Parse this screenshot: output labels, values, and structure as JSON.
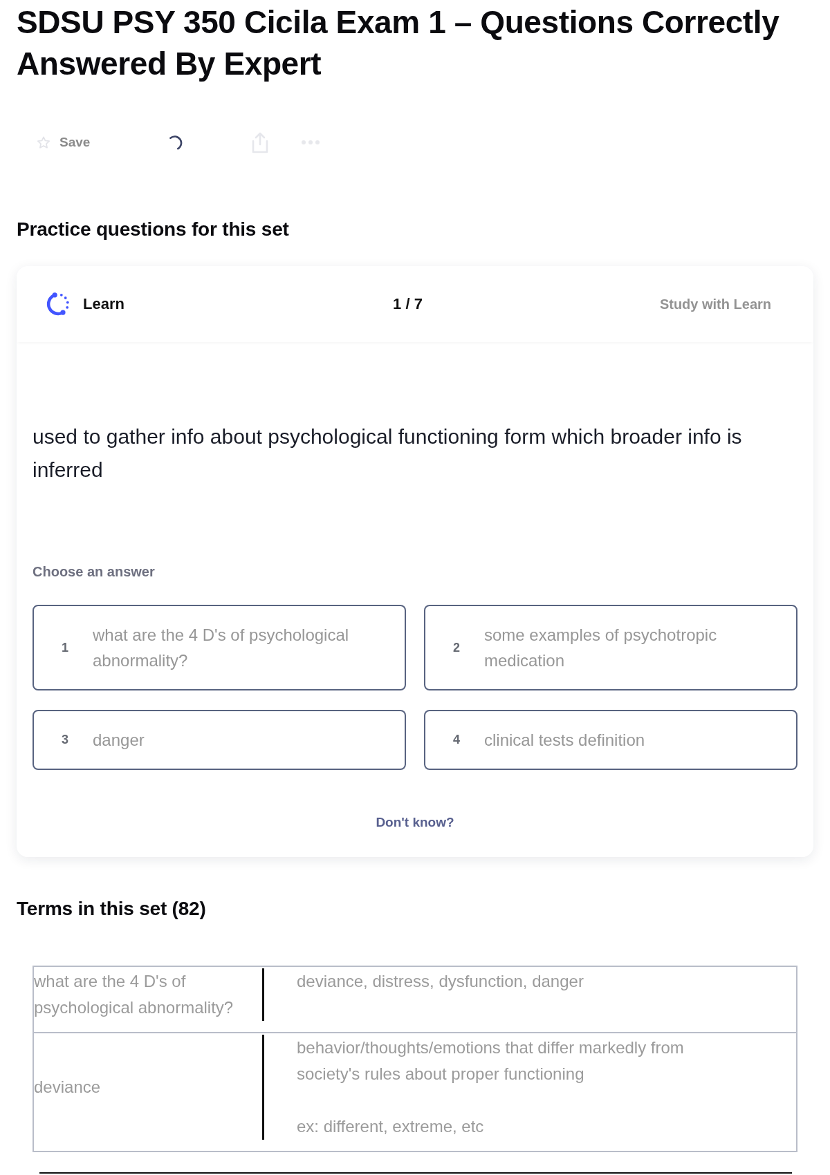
{
  "title": "SDSU PSY 350 Cicila Exam 1 – Questions Correctly Answered By Expert",
  "toolbar": {
    "save_label": "Save"
  },
  "practice": {
    "heading": "Practice questions for this set",
    "card": {
      "mode_label": "Learn",
      "progress": "1 / 7",
      "study_link": "Study with Learn",
      "question": "used to gather info about psychological functioning form which broader info is inferred",
      "prompt": "Choose an answer",
      "answers": [
        {
          "number": "1",
          "text": "what are the 4 D's of psychological abnormality?"
        },
        {
          "number": "2",
          "text": "some examples of psychotropic medication"
        },
        {
          "number": "3",
          "text": "danger"
        },
        {
          "number": "4",
          "text": "clinical tests definition"
        }
      ],
      "dont_know": "Don't know?"
    }
  },
  "terms": {
    "heading": "Terms in this set (82)",
    "rows": [
      {
        "term": "what are the 4 D's of psychological abnormality?",
        "definition": [
          "deviance, distress, dysfunction, danger"
        ]
      },
      {
        "term": "deviance",
        "definition": [
          "behavior/thoughts/emotions that differ markedly from society's rules about proper functioning",
          "ex: different, extreme, etc"
        ]
      }
    ]
  }
}
